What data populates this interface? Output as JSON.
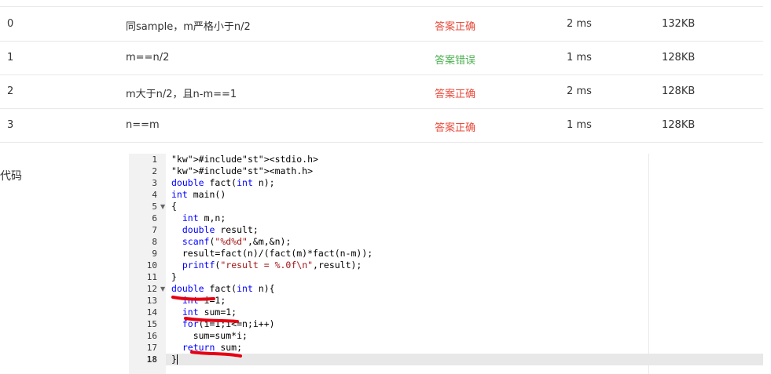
{
  "results": [
    {
      "id": "0",
      "desc": "同sample，m严格小于n/2",
      "status": "答案正确",
      "status_type": "ok",
      "time": "2 ms",
      "memory": "132KB"
    },
    {
      "id": "1",
      "desc": "m==n/2",
      "status": "答案错误",
      "status_type": "bad",
      "time": "1 ms",
      "memory": "128KB"
    },
    {
      "id": "2",
      "desc": "m大于n/2，且n-m==1",
      "status": "答案正确",
      "status_type": "ok",
      "time": "2 ms",
      "memory": "128KB"
    },
    {
      "id": "3",
      "desc": "n==m",
      "status": "答案正确",
      "status_type": "ok",
      "time": "1 ms",
      "memory": "128KB"
    }
  ],
  "code_label": "代码",
  "code": {
    "line_numbers": [
      "1",
      "2",
      "3",
      "4",
      "5",
      "6",
      "7",
      "8",
      "9",
      "10",
      "11",
      "12",
      "13",
      "14",
      "15",
      "16",
      "17",
      "18"
    ],
    "lines": [
      "#include<stdio.h>",
      "#include<math.h>",
      "double fact(int n);",
      "int main()",
      "{",
      "  int m,n;",
      "  double result;",
      "  scanf(\"%d%d\",&m,&n);",
      "  result=fact(n)/(fact(m)*fact(n-m));",
      "  printf(\"result = %.0f\\n\",result);",
      "}",
      "double fact(int n){",
      "  int i=1;",
      "  int sum=1;",
      "  for(i=1;i<=n;i++)",
      "    sum=sum*i;",
      "  return sum;",
      "}"
    ]
  },
  "colors": {
    "correct": "#e74c3c",
    "wrong": "#4caf50",
    "annotation": "#e60012"
  }
}
